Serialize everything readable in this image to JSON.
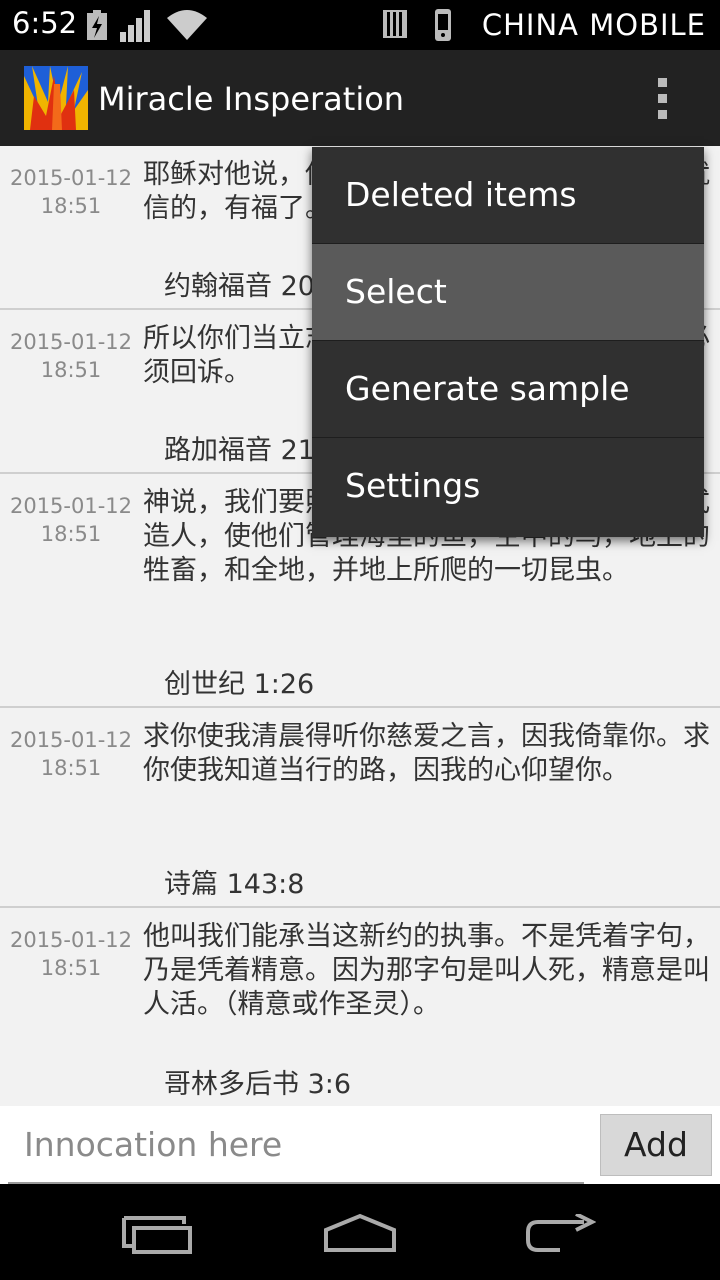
{
  "status_bar": {
    "time": "6:52",
    "carrier": "CHINA  MOBILE"
  },
  "action_bar": {
    "title": "Miracle Insperation"
  },
  "entries": [
    {
      "date": "2015-01-12",
      "time": "18:51",
      "text": "耶稣对他说，你因看见了我才信。那没有看见就信的，有福了。",
      "ref": "约翰福音 20:29"
    },
    {
      "date": "2015-01-12",
      "time": "18:51",
      "text": "所以你们当立志作主的门徒，不要倚靠自己，必须回诉。",
      "ref": "路加福音 21"
    },
    {
      "date": "2015-01-12",
      "time": "18:51",
      "text": "神说，我们要照着我们的形像，按着我们的样式造人，使他们管理海里的鱼，空中的鸟，地上的牲畜，和全地，并地上所爬的一切昆虫。",
      "ref": "创世纪 1:26"
    },
    {
      "date": "2015-01-12",
      "time": "18:51",
      "text": "求你使我清晨得听你慈爱之言，因我倚靠你。求你使我知道当行的路，因我的心仰望你。",
      "ref": "诗篇 143:8"
    },
    {
      "date": "2015-01-12",
      "time": "18:51",
      "text": "他叫我们能承当这新约的执事。不是凭着字句，乃是凭着精意。因为那字句是叫人死，精意是叫人活。（精意或作圣灵）。",
      "ref": "哥林多后书 3:6"
    }
  ],
  "menu": {
    "items": [
      {
        "label": "Deleted items"
      },
      {
        "label": "Select"
      },
      {
        "label": "Generate sample"
      },
      {
        "label": "Settings"
      }
    ]
  },
  "input_bar": {
    "placeholder": "Innocation here",
    "add_label": "Add"
  }
}
